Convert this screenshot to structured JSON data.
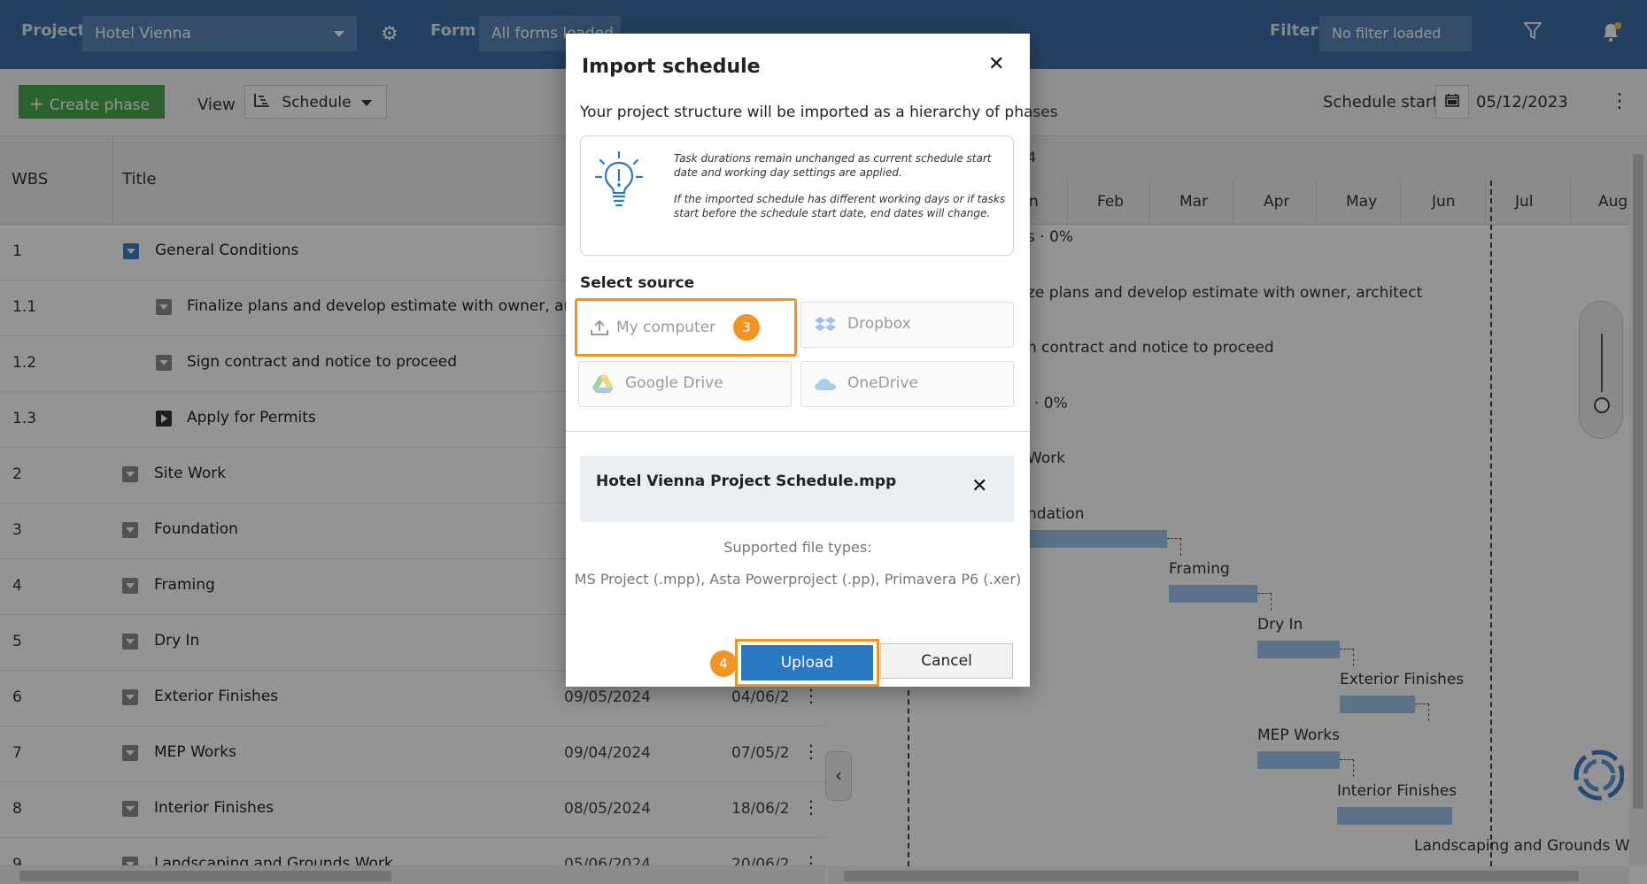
{
  "topbar": {
    "project_label": "Project",
    "project_value": "Hotel Vienna",
    "form_label": "Form",
    "form_value": "All forms loaded",
    "filter_label": "Filter",
    "filter_value": "No filter loaded"
  },
  "toolbar": {
    "create_phase": "Create phase",
    "view_label": "View",
    "view_value": "Schedule",
    "schedule_start_label": "Schedule start",
    "schedule_start_value": "05/12/2023"
  },
  "grid": {
    "headers": {
      "wbs": "WBS",
      "title": "Title"
    },
    "rows": [
      {
        "wbs": "1",
        "title": "General Conditions",
        "start": "",
        "end": ""
      },
      {
        "wbs": "1.1",
        "title": "Finalize plans and develop estimate with owner, arc...",
        "start": "",
        "end": ""
      },
      {
        "wbs": "1.2",
        "title": "Sign contract and notice to proceed",
        "start": "",
        "end": ""
      },
      {
        "wbs": "1.3",
        "title": "Apply for Permits",
        "start": "",
        "end": ""
      },
      {
        "wbs": "2",
        "title": "Site Work",
        "start": "",
        "end": ""
      },
      {
        "wbs": "3",
        "title": "Foundation",
        "start": "",
        "end": ""
      },
      {
        "wbs": "4",
        "title": "Framing",
        "start": "",
        "end": ""
      },
      {
        "wbs": "5",
        "title": "Dry In",
        "start": "",
        "end": ""
      },
      {
        "wbs": "6",
        "title": "Exterior Finishes",
        "start": "09/05/2024",
        "end": "04/06/2"
      },
      {
        "wbs": "7",
        "title": "MEP Works",
        "start": "09/04/2024",
        "end": "07/05/2"
      },
      {
        "wbs": "8",
        "title": "Interior Finishes",
        "start": "08/05/2024",
        "end": "18/06/2"
      },
      {
        "wbs": "9",
        "title": "Landscaping and Grounds Work",
        "start": "05/06/2024",
        "end": "20/06/2"
      }
    ]
  },
  "gantt": {
    "year_fragment": "4",
    "months": [
      "n",
      "Feb",
      "Mar",
      "Apr",
      "May",
      "Jun",
      "Jul",
      "Aug"
    ],
    "labels": {
      "general": "s · 0%",
      "finalize": "ze plans and develop estimate with owner, architect",
      "sign": "n contract and notice to proceed",
      "permits": "· 0%",
      "sitework": "Work",
      "foundation": "ndation",
      "framing": "Framing",
      "dryin": "Dry In",
      "exterior": "Exterior Finishes",
      "mep": "MEP Works",
      "interior": "Interior Finishes",
      "landscaping": "Landscaping and Grounds Work"
    }
  },
  "modal": {
    "title": "Import schedule",
    "subtitle": "Your project structure will be imported as a hierarchy of phases",
    "note_1": "Task durations remain unchanged as current schedule start date and working day settings are applied.",
    "note_2": "If the imported schedule has different working days or if tasks start before the schedule start date, end dates will change.",
    "select_source_label": "Select source",
    "sources": [
      {
        "label": "My computer",
        "icon": "upload-icon",
        "selected": true
      },
      {
        "label": "Dropbox",
        "icon": "dropbox-icon",
        "selected": false
      },
      {
        "label": "Google Drive",
        "icon": "google-drive-icon",
        "selected": false
      },
      {
        "label": "OneDrive",
        "icon": "onedrive-icon",
        "selected": false
      }
    ],
    "step_badge_source": "3",
    "step_badge_upload": "4",
    "file_name": "Hotel Vienna Project Schedule.mpp",
    "supported_label": "Supported file types:",
    "supported_types": "MS Project (.mpp), Asta Powerproject (.pp), Primavera P6 (.xer)",
    "upload_label": "Upload",
    "cancel_label": "Cancel",
    "highlight_color": "#f39324",
    "primary_color": "#2a78c2"
  }
}
